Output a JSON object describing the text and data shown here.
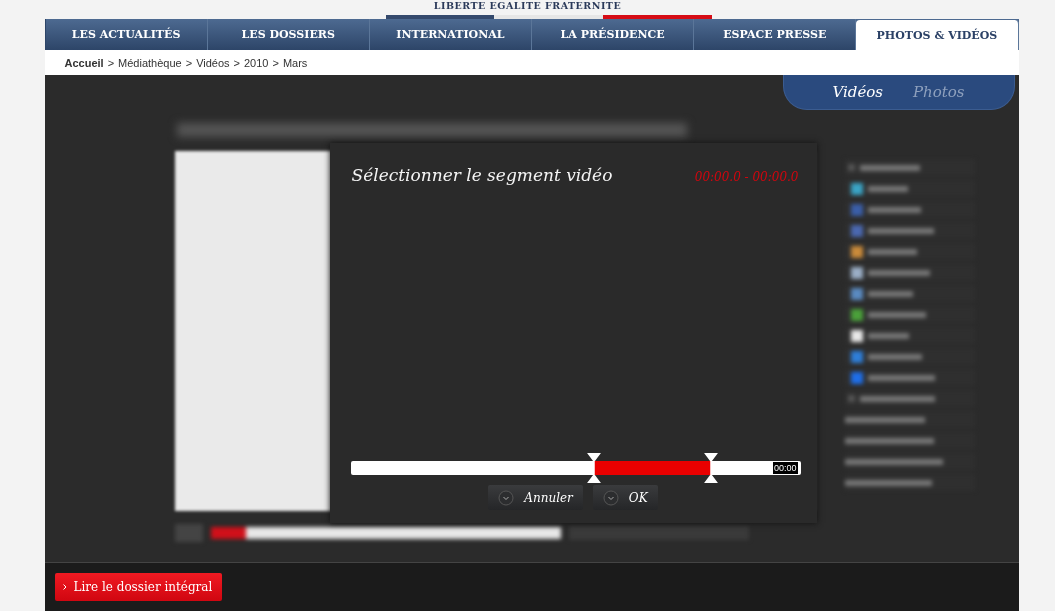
{
  "motto": "LIBERTE EGALITE FRATERNITE",
  "nav": [
    {
      "label": "LES ACTUALITÉS",
      "selected": false
    },
    {
      "label": "LES DOSSIERS",
      "selected": false
    },
    {
      "label": "INTERNATIONAL",
      "selected": false
    },
    {
      "label": "LA PRÉSIDENCE",
      "selected": false
    },
    {
      "label": "ESPACE PRESSE",
      "selected": false
    },
    {
      "label": "PHOTOS & VIDÉOS",
      "selected": true
    }
  ],
  "breadcrumb": [
    {
      "label": "Accueil"
    },
    {
      "separator": ">",
      "label": "Médiathèque"
    },
    {
      "separator": ">",
      "label": "Vidéos"
    },
    {
      "separator": ">",
      "label": "2010"
    },
    {
      "separator": ">",
      "label": "Mars"
    }
  ],
  "media_tabs": [
    {
      "label": "Vidéos",
      "selected": true
    },
    {
      "label": "Photos",
      "selected": false
    }
  ],
  "dialog": {
    "title": "Sélectionner le segment vidéo",
    "range": "00:00.0 - 00:00.0",
    "handles": [
      {
        "level": 0.54
      },
      {
        "level": 0.8
      }
    ],
    "time": "00:00",
    "buttons": [
      "Annuler",
      "OK"
    ]
  },
  "footer_button": "Lire le dossier intégral"
}
